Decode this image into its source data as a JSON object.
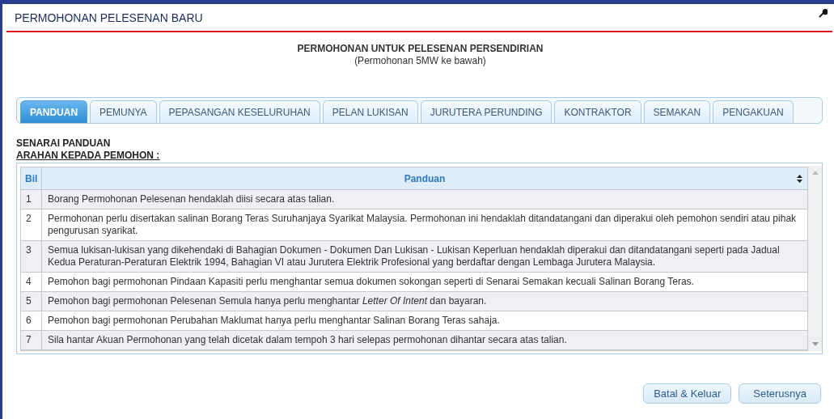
{
  "header": {
    "title": "PERMOHONAN PELESENAN BARU"
  },
  "heading": {
    "title": "PERMOHONAN UNTUK PELESENAN PERSENDIRIAN",
    "subtitle": "(Permohonan 5MW ke bawah)"
  },
  "tabs": [
    {
      "label": "PANDUAN",
      "selected": true
    },
    {
      "label": "PEMUNYA",
      "selected": false
    },
    {
      "label": "PEPASANGAN KESELURUHAN",
      "selected": false
    },
    {
      "label": "PELAN LUKISAN",
      "selected": false
    },
    {
      "label": "JURUTERA PERUNDING",
      "selected": false
    },
    {
      "label": "KONTRAKTOR",
      "selected": false
    },
    {
      "label": "SEMAKAN",
      "selected": false
    },
    {
      "label": "PENGAKUAN",
      "selected": false
    }
  ],
  "section": {
    "title": "SENARAI PANDUAN",
    "subtitle": "ARAHAN KEPADA PEMOHON :"
  },
  "table": {
    "columns": [
      "Bil",
      "Panduan"
    ],
    "rows": [
      {
        "bil": "1",
        "text": "Borang Permohonan Pelesenan hendaklah diisi secara atas talian."
      },
      {
        "bil": "2",
        "text": "Permohonan perlu disertakan salinan Borang Teras Suruhanjaya Syarikat Malaysia. Permohonan ini hendaklah ditandatangani dan diperakui oleh pemohon sendiri atau pihak pengurusan syarikat."
      },
      {
        "bil": "3",
        "text": "Semua lukisan-lukisan yang dikehendaki di Bahagian Dokumen - Dokumen Dan Lukisan - Lukisan Keperluan hendaklah diperakui dan ditandatangani seperti pada Jadual Kedua Peraturan-Peraturan Elektrik 1994, Bahagian VI atau Jurutera Elektrik Profesional yang berdaftar dengan Lembaga Jurutera Malaysia."
      },
      {
        "bil": "4",
        "text": "Pemohon bagi permohonan Pindaan Kapasiti perlu menghantar semua dokumen sokongan seperti di Senarai Semakan kecuali Salinan Borang Teras."
      },
      {
        "bil": "5",
        "text": "Pemohon bagi permohonan Pelesenan Semula hanya perlu menghantar *Letter Of Intent* dan bayaran."
      },
      {
        "bil": "6",
        "text": "Pemohon bagi permohonan Perubahan Maklumat hanya perlu menghantar Salinan Borang Teras sahaja."
      },
      {
        "bil": "7",
        "text": "Sila hantar Akuan Permohonan yang telah dicetak dalam tempoh 3 hari selepas permohonan dihantar secara atas talian."
      }
    ]
  },
  "buttons": [
    "Batal & Keluar",
    "Seterusnya"
  ]
}
